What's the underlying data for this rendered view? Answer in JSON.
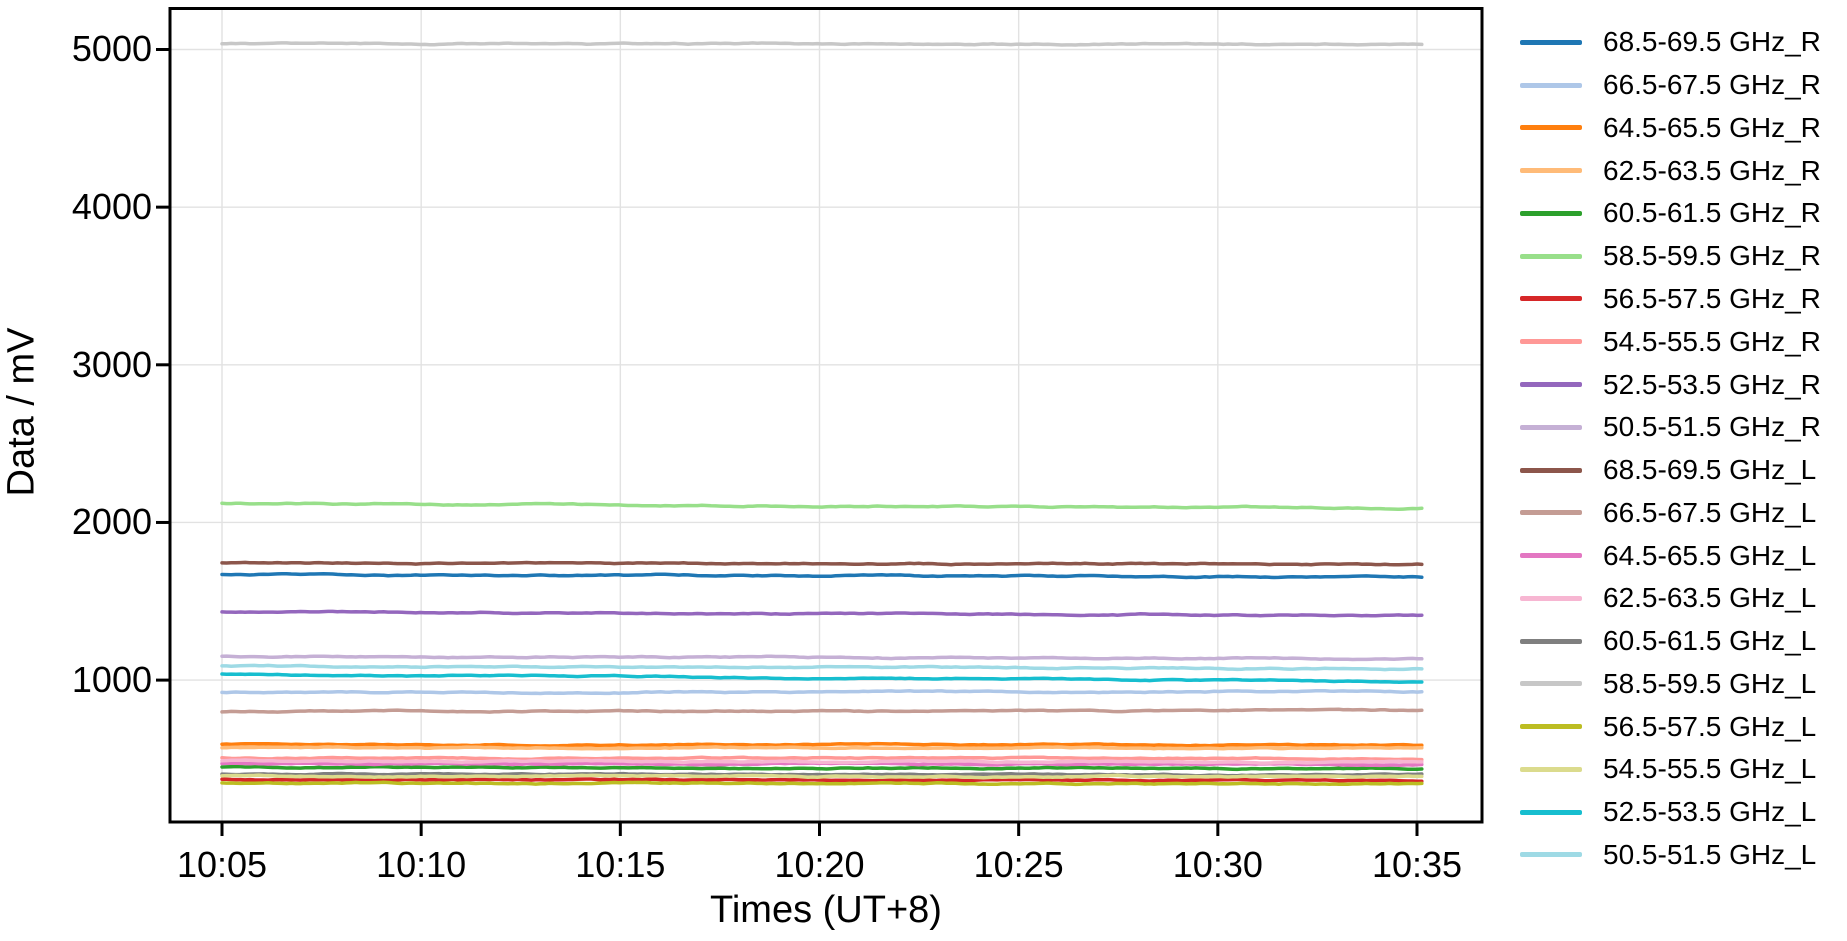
{
  "figure": {
    "background_color": "#ffffff",
    "spine_color": "#000000",
    "grid_color": "#e2e2e2",
    "tick_color": "#000000",
    "text_color": "#000000"
  },
  "chart_data": {
    "type": "line",
    "title": "",
    "xlabel": "Times (UT+8)",
    "ylabel": "Data / mV",
    "x_tick_labels": [
      "10:05",
      "10:10",
      "10:15",
      "10:20",
      "10:25",
      "10:30",
      "10:35"
    ],
    "x_tick_minutes": [
      0,
      5,
      10,
      15,
      20,
      25,
      30
    ],
    "y_ticks": [
      1000,
      2000,
      3000,
      4000,
      5000
    ],
    "y_tick_labels": [
      "1000",
      "2000",
      "3000",
      "4000",
      "5000"
    ],
    "ylim": [
      100,
      5260
    ],
    "xlim_minutes": [
      -1.32,
      31.65
    ],
    "grid": true,
    "legend_position": "right-outside",
    "series": [
      {
        "name": "68.5-69.5 GHz_R",
        "color": "#1f77b4",
        "start_mv": 1668,
        "end_mv": 1656
      },
      {
        "name": "66.5-67.5 GHz_R",
        "color": "#aec7e8",
        "start_mv": 922,
        "end_mv": 928
      },
      {
        "name": "64.5-65.5 GHz_R",
        "color": "#ff7f0e",
        "start_mv": 592,
        "end_mv": 588
      },
      {
        "name": "62.5-63.5 GHz_R",
        "color": "#ffbb78",
        "start_mv": 572,
        "end_mv": 568
      },
      {
        "name": "60.5-61.5 GHz_R",
        "color": "#2ca02c",
        "start_mv": 448,
        "end_mv": 440
      },
      {
        "name": "58.5-59.5 GHz_R",
        "color": "#98df8a",
        "start_mv": 2122,
        "end_mv": 2090
      },
      {
        "name": "56.5-57.5 GHz_R",
        "color": "#d62728",
        "start_mv": 370,
        "end_mv": 363
      },
      {
        "name": "54.5-55.5 GHz_R",
        "color": "#ff9896",
        "start_mv": 508,
        "end_mv": 500
      },
      {
        "name": "52.5-53.5 GHz_R",
        "color": "#9467bd",
        "start_mv": 1432,
        "end_mv": 1410
      },
      {
        "name": "50.5-51.5 GHz_R",
        "color": "#c5b0d5",
        "start_mv": 1152,
        "end_mv": 1137
      },
      {
        "name": "68.5-69.5 GHz_L",
        "color": "#8c564b",
        "start_mv": 1742,
        "end_mv": 1736
      },
      {
        "name": "66.5-67.5 GHz_L",
        "color": "#c49c94",
        "start_mv": 800,
        "end_mv": 806
      },
      {
        "name": "64.5-65.5 GHz_L",
        "color": "#e377c2",
        "start_mv": 470,
        "end_mv": 466
      },
      {
        "name": "62.5-63.5 GHz_L",
        "color": "#f7b6d2",
        "start_mv": 486,
        "end_mv": 481
      },
      {
        "name": "60.5-61.5 GHz_L",
        "color": "#7f7f7f",
        "start_mv": 404,
        "end_mv": 399
      },
      {
        "name": "58.5-59.5 GHz_L",
        "color": "#c7c7c7",
        "start_mv": 5037,
        "end_mv": 5033
      },
      {
        "name": "56.5-57.5 GHz_L",
        "color": "#bcbd22",
        "start_mv": 346,
        "end_mv": 341
      },
      {
        "name": "54.5-55.5 GHz_L",
        "color": "#dbdb8d",
        "start_mv": 392,
        "end_mv": 387
      },
      {
        "name": "52.5-53.5 GHz_L",
        "color": "#17becf",
        "start_mv": 1040,
        "end_mv": 988
      },
      {
        "name": "50.5-51.5 GHz_L",
        "color": "#9edae5",
        "start_mv": 1092,
        "end_mv": 1072
      }
    ]
  }
}
